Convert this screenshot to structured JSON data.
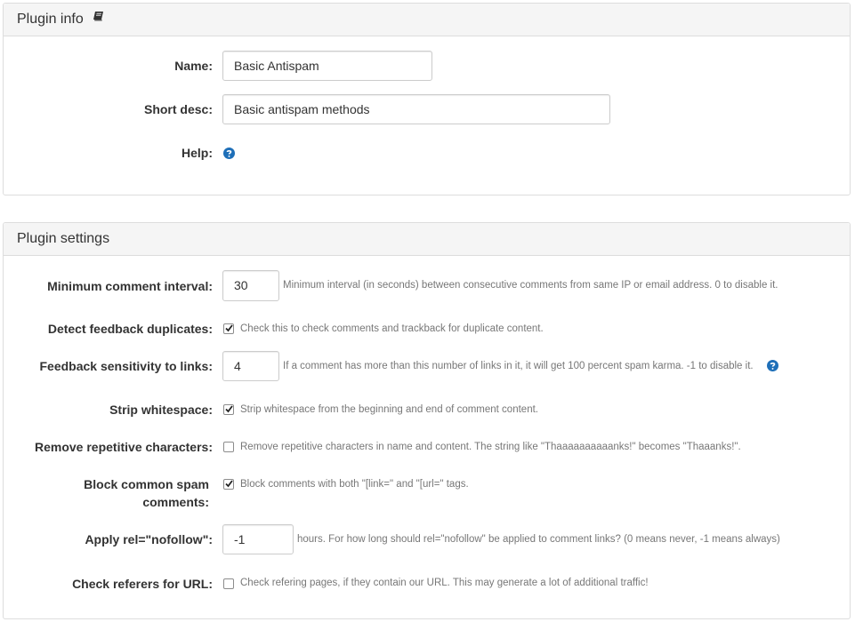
{
  "plugin_info": {
    "title": "Plugin info",
    "title_icon": "book-icon",
    "name_label": "Name:",
    "name_value": "Basic Antispam",
    "short_desc_label": "Short desc:",
    "short_desc_value": "Basic antispam methods",
    "help_label": "Help:",
    "help_icon": "question-circle-icon"
  },
  "plugin_settings": {
    "title": "Plugin settings",
    "min_interval": {
      "label": "Minimum comment interval:",
      "value": "30",
      "note": "Minimum interval (in seconds) between consecutive comments from same IP or email address. 0 to disable it."
    },
    "detect_duplicates": {
      "label": "Detect feedback duplicates:",
      "checked": true,
      "note": "Check this to check comments and trackback for duplicate content."
    },
    "link_sensitivity": {
      "label": "Feedback sensitivity to links:",
      "value": "4",
      "note": "If a comment has more than this number of links in it, it will get 100 percent spam karma. -1 to disable it.",
      "help_icon": "question-circle-icon"
    },
    "strip_whitespace": {
      "label": "Strip whitespace:",
      "checked": true,
      "note": "Strip whitespace from the beginning and end of comment content."
    },
    "remove_repetitive": {
      "label": "Remove repetitive characters:",
      "checked": false,
      "note": "Remove repetitive characters in name and content. The string like \"Thaaaaaaaaaanks!\" becomes \"Thaaanks!\"."
    },
    "block_spam": {
      "label": "Block common spam comments:",
      "checked": true,
      "note": "Block comments with both \"[link=\" and \"[url=\" tags."
    },
    "nofollow": {
      "label": "Apply rel=\"nofollow\":",
      "value": "-1",
      "note": "hours. For how long should rel=\"nofollow\" be applied to comment links? (0 means never, -1 means always)"
    },
    "check_referers": {
      "label": "Check referers for URL:",
      "checked": false,
      "note": "Check refering pages, if they contain our URL. This may generate a lot of additional traffic!"
    }
  },
  "colors": {
    "heading_bg": "#f5f5f5",
    "border": "#dddddd",
    "help_icon_blue": "#1e6fb8",
    "note_text": "#777777"
  }
}
